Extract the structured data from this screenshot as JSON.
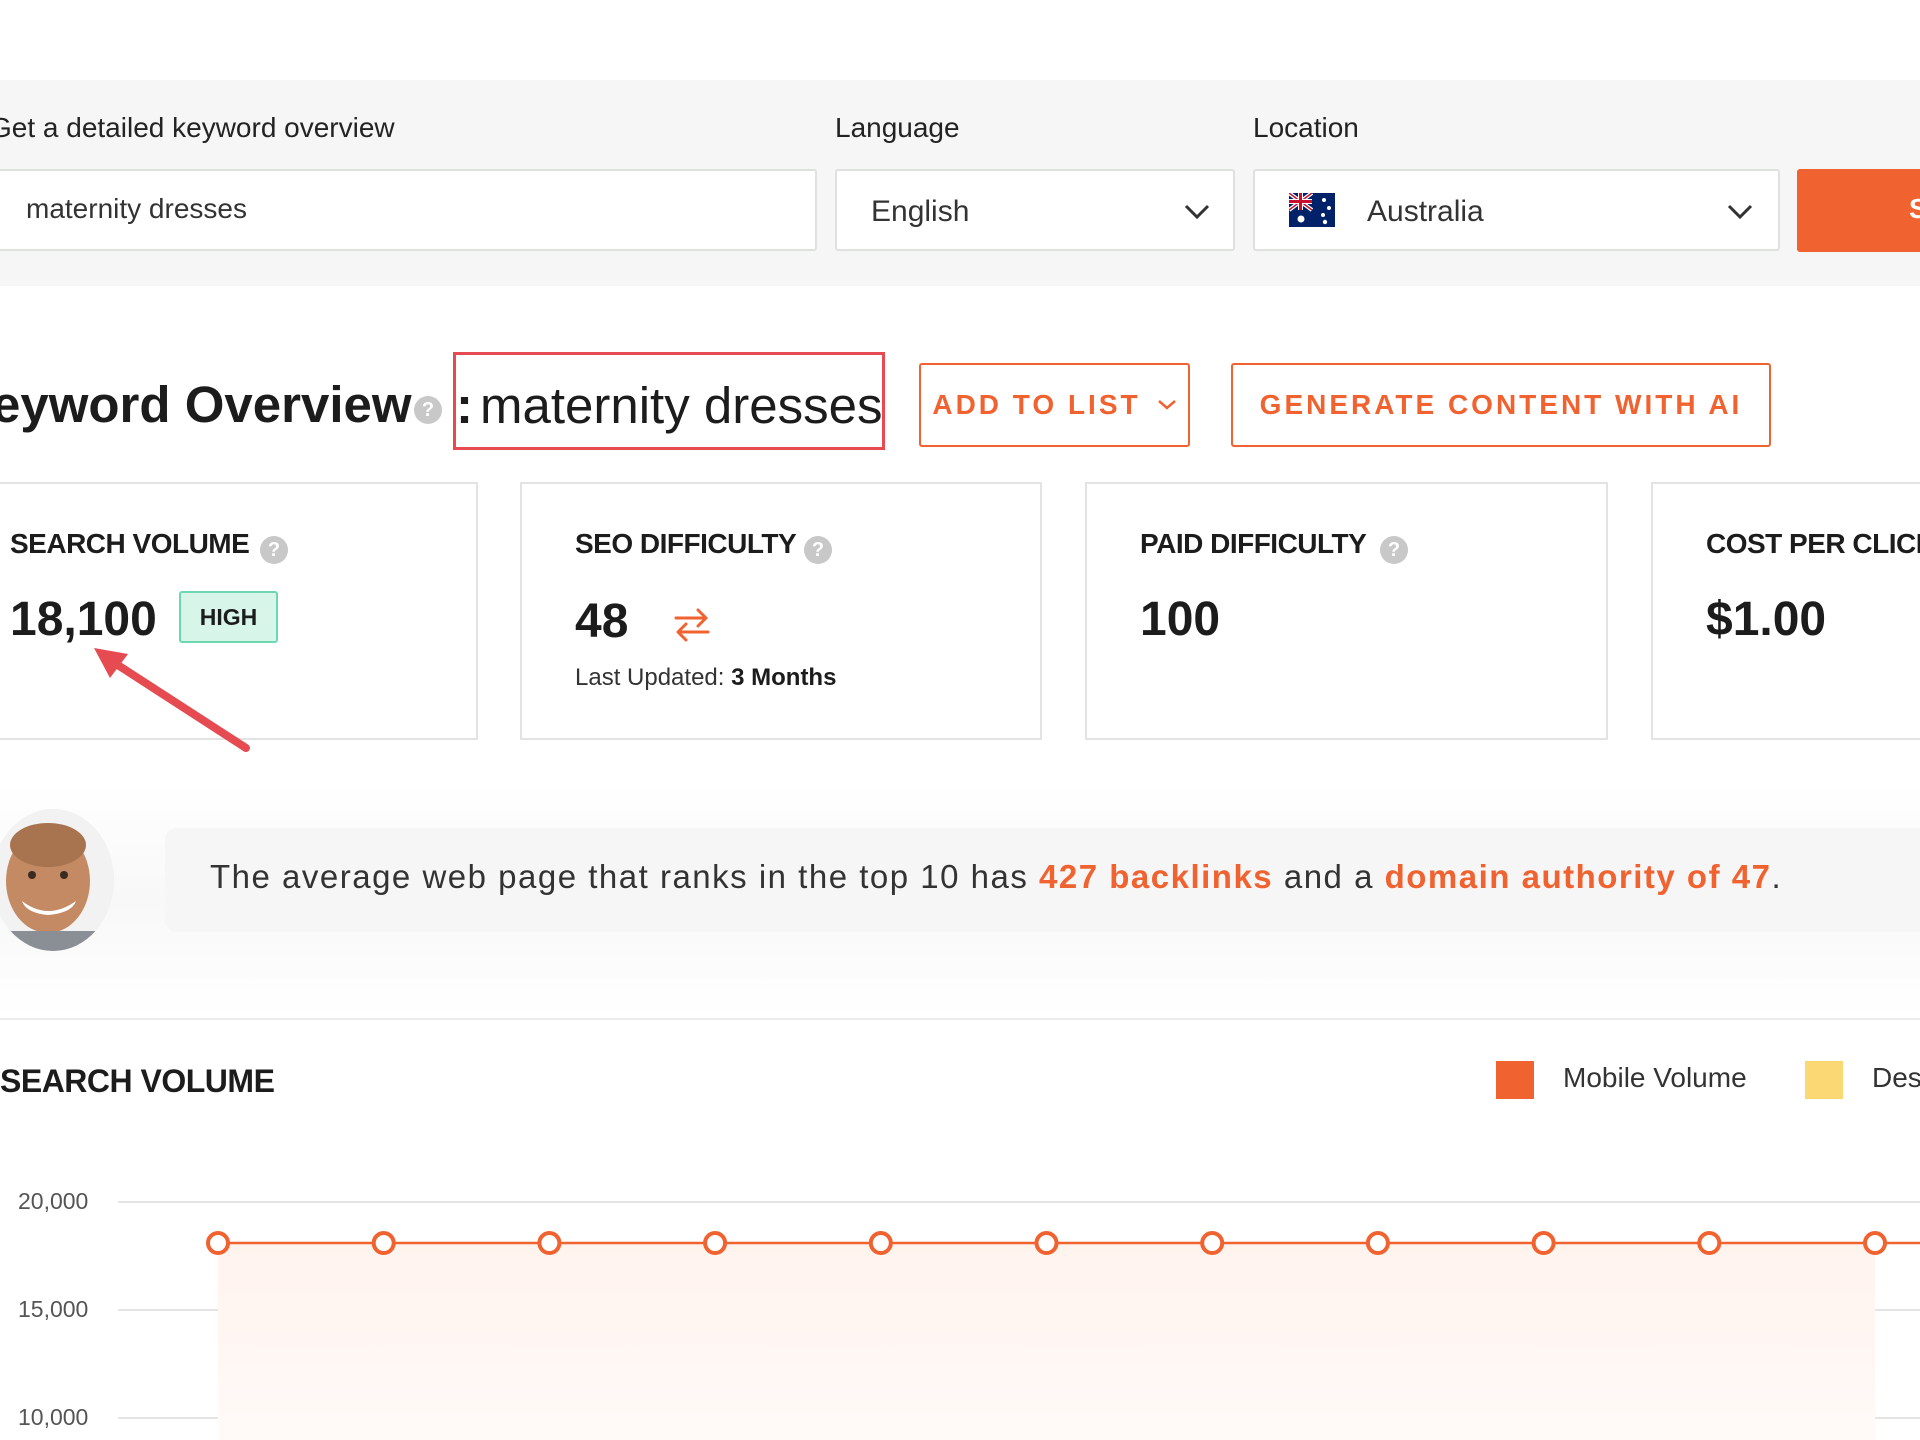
{
  "search": {
    "keyword_label": "Get a detailed keyword overview",
    "keyword_value": "maternity dresses",
    "language_label": "Language",
    "language_value": "English",
    "location_label": "Location",
    "location_value": "Australia",
    "submit_label": "S"
  },
  "overview": {
    "title": "eyword Overview",
    "separator": ":",
    "keyword": "maternity dresses",
    "add_to_list_label": "ADD TO LIST",
    "generate_label": "GENERATE CONTENT WITH AI"
  },
  "metrics": {
    "search_volume": {
      "title": "SEARCH VOLUME",
      "value": "18,100",
      "badge": "HIGH"
    },
    "seo_difficulty": {
      "title": "SEO DIFFICULTY",
      "value": "48",
      "updated_prefix": "Last Updated:",
      "updated_value": "3 Months"
    },
    "paid_difficulty": {
      "title": "PAID DIFFICULTY",
      "value": "100"
    },
    "cost_per_click": {
      "title": "COST PER CLICK",
      "value": "$1.00"
    }
  },
  "tip": {
    "text_before": "The average web page that ranks in the top 10 has ",
    "highlight_1": "427 backlinks",
    "text_middle": " and a ",
    "highlight_2": "domain authority of 47",
    "text_after": "."
  },
  "colors": {
    "accent": "#f0622f",
    "badge_bg": "#d8f5e9",
    "badge_border": "#6ed6b0",
    "annotation_red": "#e54b50",
    "mobile_volume": "#f0622f",
    "desktop_volume": "#fcd874"
  },
  "icons": {
    "language_chevron": "chevron-down-icon",
    "location_flag": "australia-flag-icon",
    "help": "question-circle-icon",
    "refresh": "refresh-arrows-icon",
    "annotation": "red-arrow-annotation"
  },
  "chart_data": {
    "type": "line",
    "title": "SEARCH VOLUME",
    "y_ticks": [
      "20,000",
      "15,000",
      "10,000"
    ],
    "ylim": [
      10000,
      20000
    ],
    "grid": true,
    "legend_position": "top-right",
    "legend": [
      "Mobile Volume",
      "Des"
    ],
    "series": [
      {
        "name": "Mobile Volume",
        "values": [
          18100,
          18100,
          18100,
          18100,
          18100,
          18100,
          18100,
          18100,
          18100,
          18100,
          18100
        ]
      }
    ]
  }
}
